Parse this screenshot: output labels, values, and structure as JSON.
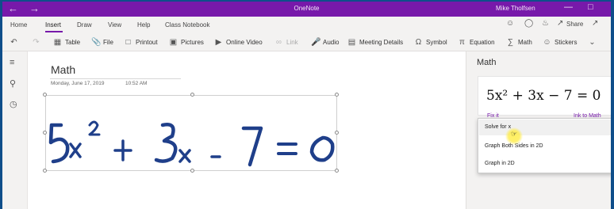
{
  "window": {
    "app_title": "OneNote",
    "user_name": "Mike Tholfsen",
    "back_icon": "arrow-left-icon",
    "forward_icon": "arrow-right-icon"
  },
  "ribbon": {
    "tabs": [
      {
        "label": "Home"
      },
      {
        "label": "Insert"
      },
      {
        "label": "Draw"
      },
      {
        "label": "View"
      },
      {
        "label": "Help"
      },
      {
        "label": "Class Notebook"
      }
    ],
    "share_label": "Share",
    "tools": [
      {
        "label": "Table",
        "icon": "table-icon"
      },
      {
        "label": "File",
        "icon": "paperclip-icon"
      },
      {
        "label": "Printout",
        "icon": "printout-icon"
      },
      {
        "label": "Pictures",
        "icon": "pictures-icon"
      },
      {
        "label": "Online Video",
        "icon": "online-video-icon"
      },
      {
        "label": "Link",
        "icon": "link-icon"
      },
      {
        "label": "Audio",
        "icon": "audio-icon"
      },
      {
        "label": "Meeting Details",
        "icon": "meeting-details-icon"
      },
      {
        "label": "Symbol",
        "icon": "symbol-icon"
      },
      {
        "label": "Equation",
        "icon": "equation-icon"
      },
      {
        "label": "Math",
        "icon": "math-icon"
      },
      {
        "label": "Stickers",
        "icon": "stickers-icon"
      }
    ]
  },
  "page": {
    "title": "Math",
    "date": "Monday, June 17, 2019",
    "time": "10:52 AM"
  },
  "math_pane": {
    "title": "Math",
    "equation": "5x² + 3x − 7 = 0",
    "fix_link": "Fix it",
    "ink_link": "Ink to Math",
    "menu": [
      "Solve for x",
      "Graph Both Sides in 2D",
      "Graph in 2D"
    ]
  },
  "colors": {
    "accent": "#7719aa",
    "ink": "#1f3f8a",
    "desktop": "#0f4e8a"
  }
}
